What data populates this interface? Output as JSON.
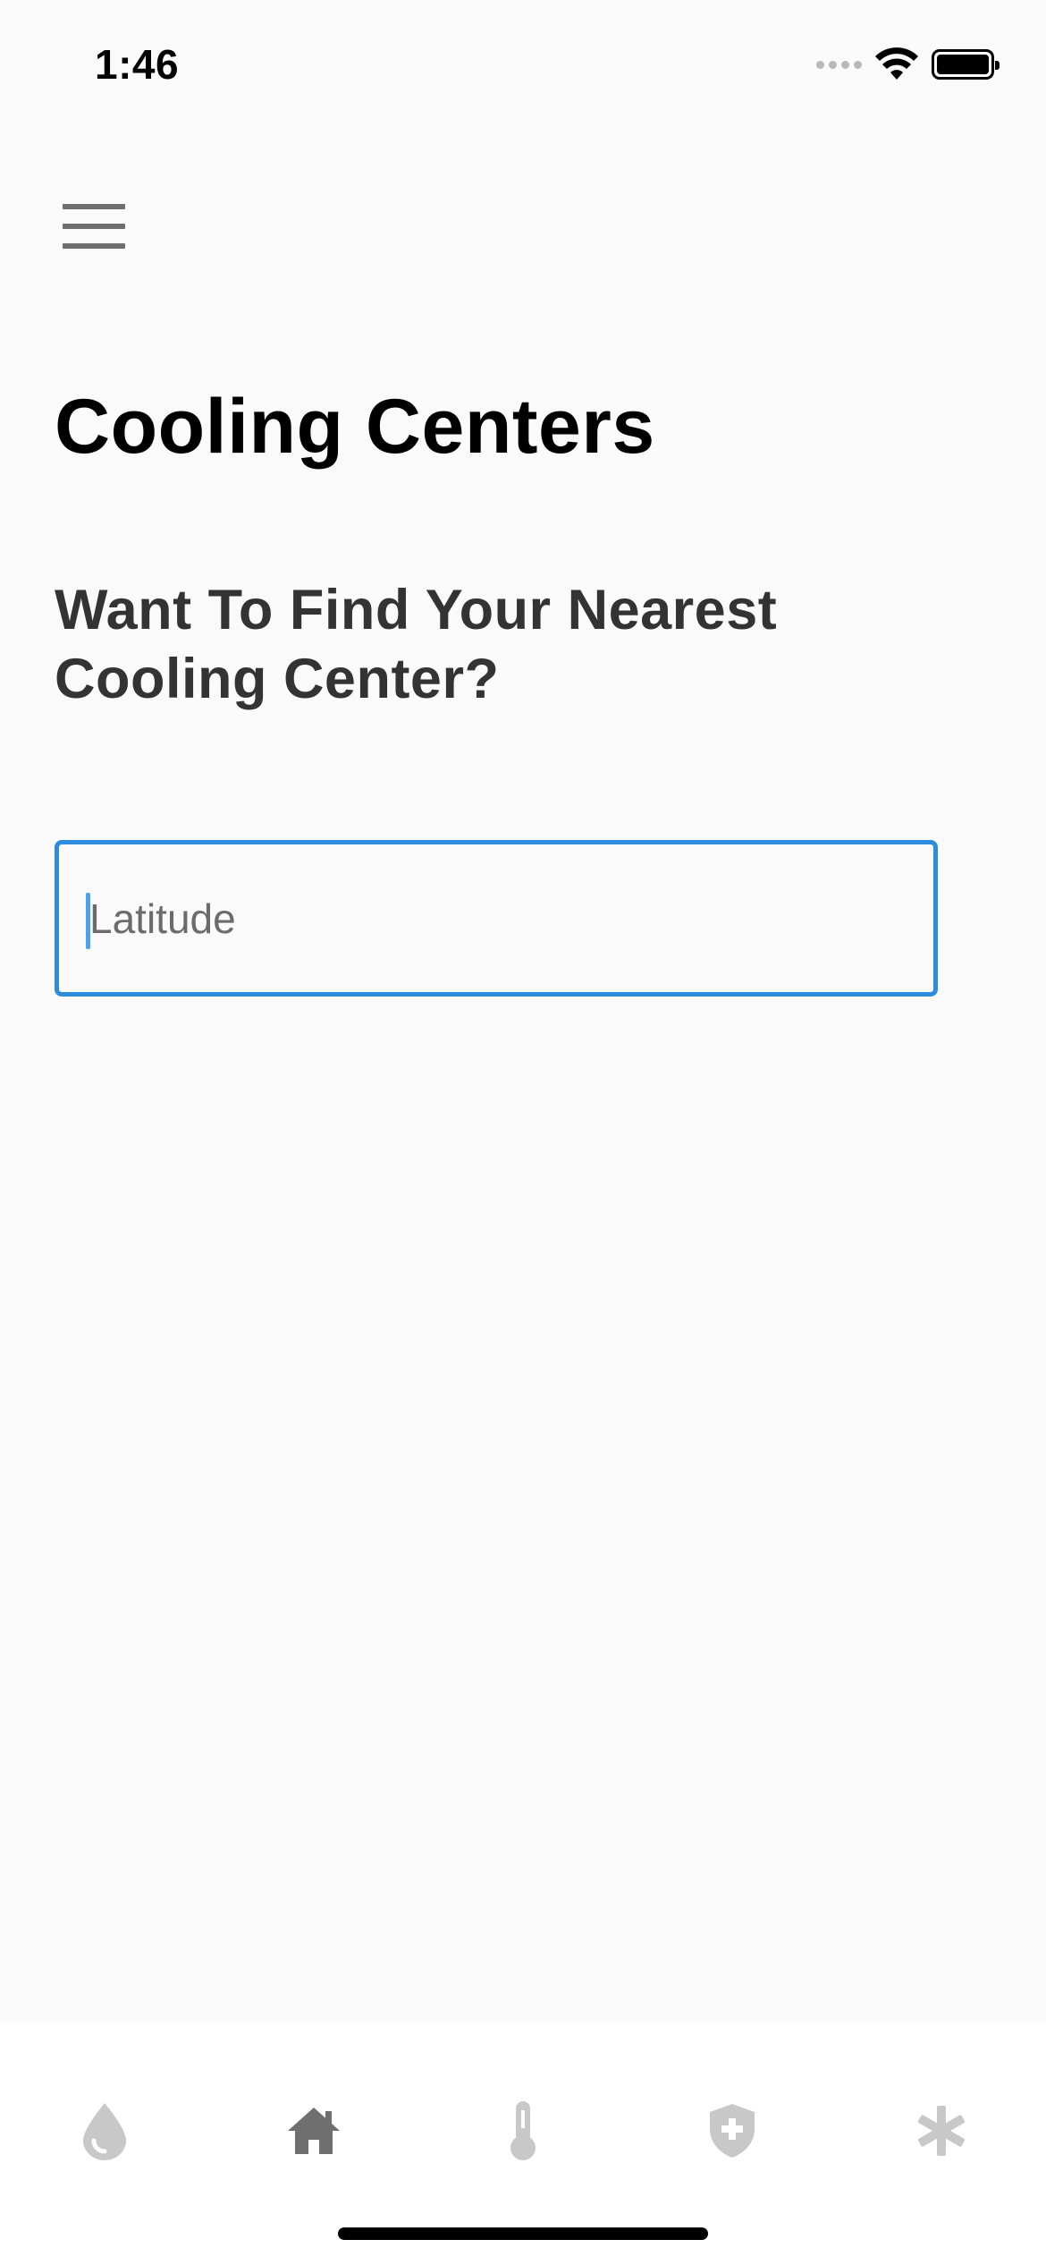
{
  "status_bar": {
    "time": "1:46"
  },
  "header": {
    "menu_icon": "hamburger-menu-icon"
  },
  "page": {
    "title": "Cooling Centers",
    "subtitle": "Want To Find Your Nearest Cooling Center?"
  },
  "form": {
    "latitude_placeholder": "Latitude",
    "latitude_value": ""
  },
  "bottom_nav": {
    "items": [
      {
        "icon": "water-drop-icon",
        "active": false
      },
      {
        "icon": "home-icon",
        "active": true
      },
      {
        "icon": "thermometer-icon",
        "active": false
      },
      {
        "icon": "shield-plus-icon",
        "active": false
      },
      {
        "icon": "asterisk-icon",
        "active": false
      }
    ]
  },
  "colors": {
    "accent": "#2d8cdc",
    "nav_active": "#6f6f6f",
    "nav_inactive": "#c8c8c8",
    "background": "#fafafa"
  }
}
